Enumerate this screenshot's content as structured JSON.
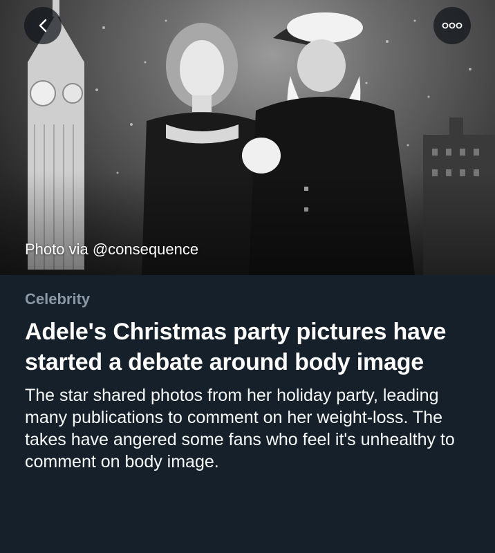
{
  "hero": {
    "photo_credit": "Photo via @consequence",
    "back_icon": "chevron-left-icon",
    "more_icon": "more-dots-icon"
  },
  "article": {
    "category": "Celebrity",
    "headline": "Adele's Christmas party pictures have started a debate around body image",
    "summary": "The star shared photos from her holiday party, leading many publications to comment on her weight-loss. The takes have angered some fans who feel it's unhealthy to comment on body image."
  },
  "colors": {
    "background": "#15202b",
    "category": "#8b98a5",
    "text": "#ffffff"
  }
}
